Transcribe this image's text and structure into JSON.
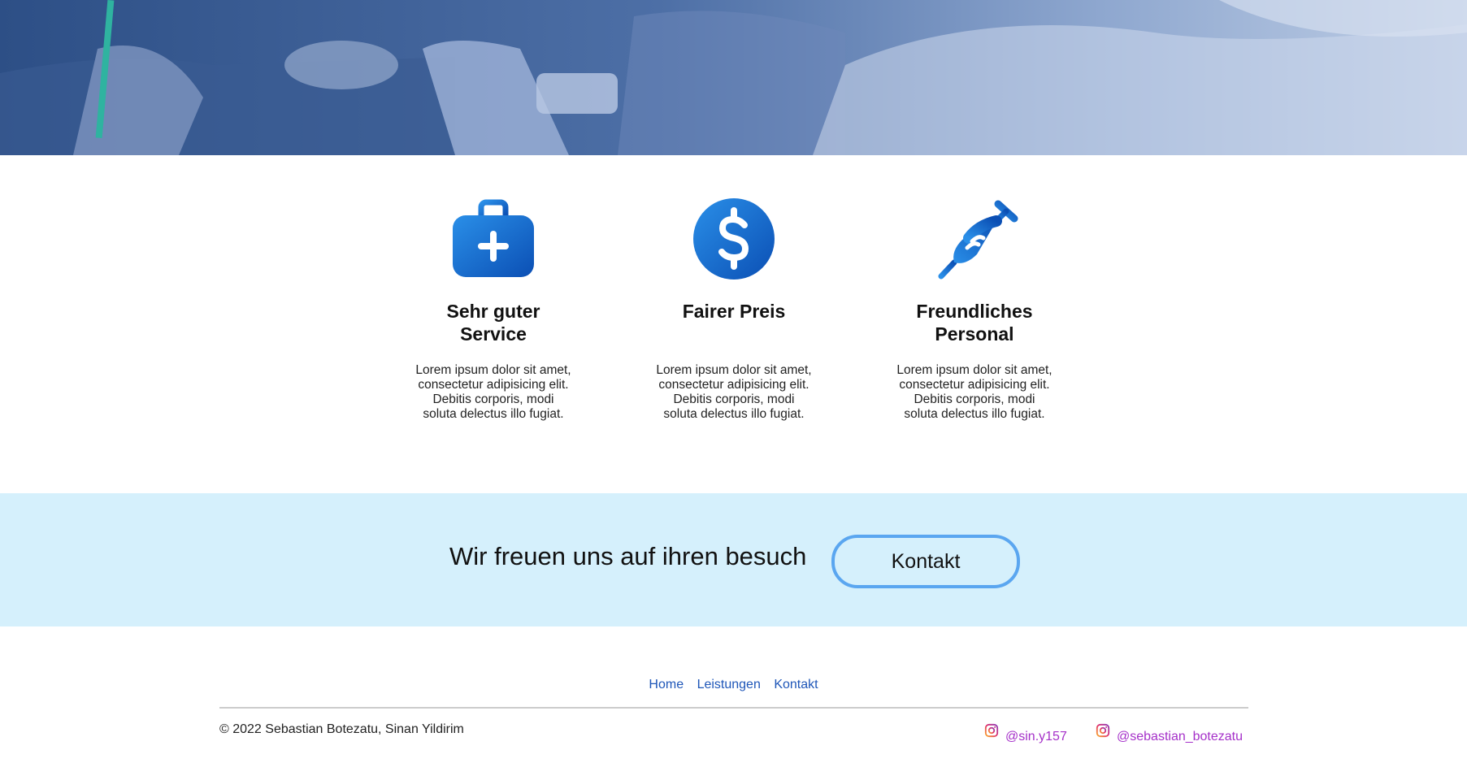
{
  "features": [
    {
      "icon": "medical-kit-icon",
      "title": [
        "Sehr guter",
        "Service"
      ],
      "text": [
        "Lorem ipsum dolor sit amet,",
        "consectetur adipisicing elit.",
        "Debitis corporis, modi",
        "soluta delectus illo fugiat."
      ]
    },
    {
      "icon": "dollar-icon",
      "title": [
        "Fairer Preis"
      ],
      "text": [
        "Lorem ipsum dolor sit amet,",
        "consectetur adipisicing elit.",
        "Debitis corporis, modi",
        "soluta delectus illo fugiat."
      ]
    },
    {
      "icon": "syringe-icon",
      "title": [
        "Freundliches",
        "Personal"
      ],
      "text": [
        "Lorem ipsum dolor sit amet,",
        "consectetur adipisicing elit.",
        "Debitis corporis, modi",
        "soluta delectus illo fugiat."
      ]
    }
  ],
  "cta": {
    "text": "Wir freuen uns auf ihren besuch",
    "button": "Kontakt"
  },
  "footer": {
    "nav": [
      "Home",
      "Leistungen",
      "Kontakt"
    ],
    "copyright": "© 2022 Sebastian Botezatu, Sinan Yildirim",
    "socials": [
      {
        "icon": "instagram-icon",
        "handle": "@sin.y157"
      },
      {
        "icon": "instagram-icon",
        "handle": "@sebastian_botezatu"
      }
    ]
  },
  "colors": {
    "accent": "#1e56b8",
    "cta_band": "#d5f0fc",
    "button_border": "#5aa6f0",
    "social": "#a530c9"
  }
}
